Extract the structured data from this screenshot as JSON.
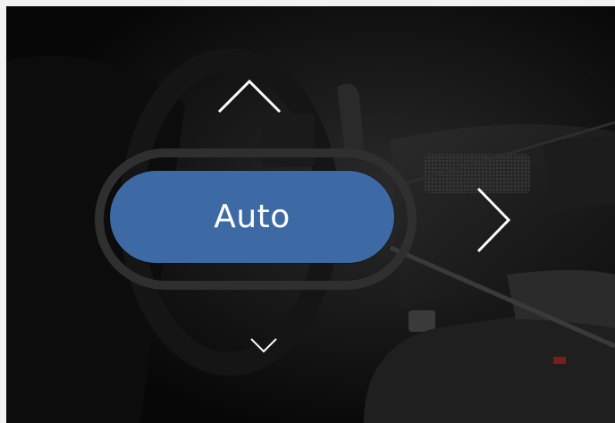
{
  "selector": {
    "mode_label": "Auto"
  },
  "icons": {
    "up": "chevron-up-icon",
    "right": "chevron-right-icon",
    "down": "chevron-down-icon"
  },
  "colors": {
    "pill": "#3d6aa5",
    "arrows": "#ffffff",
    "background": "#050505"
  }
}
